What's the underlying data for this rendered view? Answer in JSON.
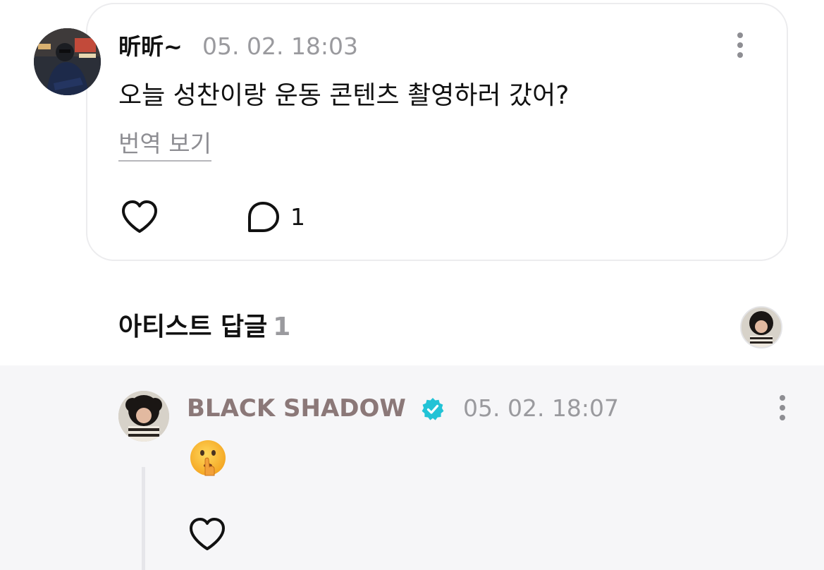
{
  "post": {
    "author": "昕昕~",
    "timestamp": "05. 02. 18:03",
    "body": "오늘 성찬이랑 운동 콘텐츠 촬영하러 갔어?",
    "translate_label": "번역 보기",
    "comment_count": "1",
    "icons": {
      "like": "heart-outline-icon",
      "comment": "speech-bubble-icon",
      "more": "vertical-ellipsis-icon"
    }
  },
  "artist_replies": {
    "title": "아티스트 답글",
    "count": "1"
  },
  "reply": {
    "author": "BLACK SHADOW",
    "verified": true,
    "timestamp": "05. 02. 18:07",
    "emoji_name": "shushing-face-emoji",
    "icons": {
      "like": "heart-outline-icon",
      "verified": "verified-badge-icon",
      "more": "vertical-ellipsis-icon"
    }
  },
  "colors": {
    "reply_author": "#8b7878",
    "verified_badge": "#22c3d6",
    "timestamp": "#9a9a9e",
    "reply_background": "#f6f6f8",
    "card_border": "#ececee"
  }
}
